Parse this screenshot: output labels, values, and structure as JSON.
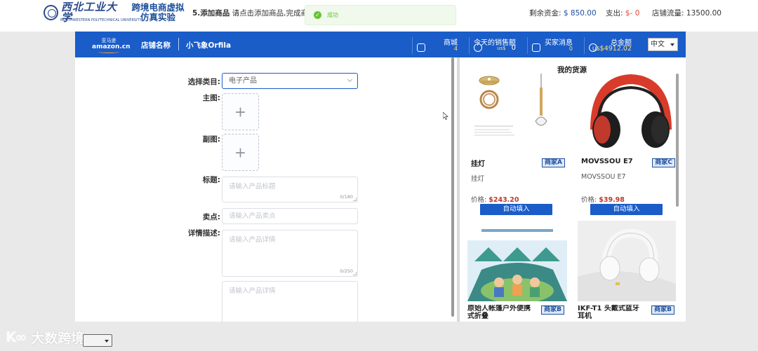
{
  "header": {
    "university_name": "西北工业大学",
    "university_en": "NORTHWESTERN POLYTECHNICAL UNIVERSITY",
    "app_title_line1": "跨境电商虚拟",
    "app_title_line2": "仿真实验",
    "step_label": "5.添加商品",
    "step_hint": "请点击添加商品,完成商品",
    "toast": "成功",
    "funds_label": "剩余资金:",
    "funds_value": "$ 850.00",
    "expense_label": "支出:",
    "expense_value": "$- 0",
    "traffic_label": "店铺流量:",
    "traffic_value": "13500.00"
  },
  "navbar": {
    "logo_cn": "亚马逊",
    "logo_en": "amazon.cn",
    "store_label": "店铺名称",
    "shop_name": "小飞象Orfila",
    "mall_label": "商城",
    "mall_value": "4",
    "sales_label": "今天的销售额",
    "sales_currency": "us$",
    "sales_value": "0",
    "messages_label": "买家消息",
    "messages_value": "0",
    "total_label": "总金额",
    "total_value": "us$4912.02",
    "language": "中文"
  },
  "form": {
    "category_label": "选择类目:",
    "category_value": "电子产品",
    "main_image_label": "主图:",
    "sub_image_label": "副图:",
    "plus": "+",
    "title_label": "标题:",
    "title_placeholder": "请输入产品标题",
    "title_count": "0/180",
    "selling_label": "卖点:",
    "selling_placeholder": "请输入产品卖点",
    "detail_label": "详情描述:",
    "detail_placeholder": "请输入产品详情",
    "detail_count": "0/250",
    "detail2_placeholder": "请输入产品详情"
  },
  "goods": {
    "title": "我的货源",
    "price_label": "价格:",
    "autofill_label": "自动填入",
    "items": [
      {
        "name": "挂灯",
        "merchant": "商家A",
        "desc": "挂灯",
        "price": "$243.20"
      },
      {
        "name": "MOVSSOU E7",
        "merchant": "商家C",
        "desc": "MOVSSOU E7",
        "price": "$39.98"
      },
      {
        "name": "原始人帐篷户外便携式折叠",
        "merchant": "商家B"
      },
      {
        "name": "IKF-T1 头戴式蓝牙耳机",
        "merchant": "商家B"
      }
    ]
  },
  "watermark": {
    "logo": "K∞",
    "text": "大数跨境"
  }
}
